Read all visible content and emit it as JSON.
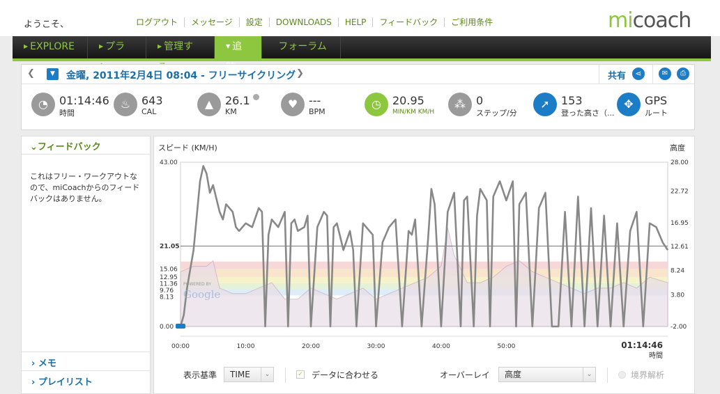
{
  "header": {
    "welcome": "ようこそ、",
    "links": [
      "ログアウト",
      "メッセージ",
      "設定",
      "DOWNLOADS",
      "HELP",
      "フィードバック",
      "ご利用条件"
    ],
    "logo_mi": "mi",
    "logo_coach": "coach"
  },
  "nav": {
    "items": [
      {
        "label": "EXPLORE",
        "active": false
      },
      {
        "label": "プラン",
        "active": false
      },
      {
        "label": "管理する",
        "active": false
      },
      {
        "label": "追跡",
        "active": true
      },
      {
        "label": "フォーラム",
        "active": false
      }
    ]
  },
  "workout": {
    "title": "金曜, 2011年2月4日 08:04 - フリーサイクリング",
    "share": "共有",
    "stats": [
      {
        "value": "01:14:46",
        "label": "時間",
        "icon": "clock-icon"
      },
      {
        "value": "643",
        "label": "CAL",
        "icon": "flame-icon"
      },
      {
        "value": "26.1",
        "label": "KM",
        "icon": "road-icon"
      },
      {
        "value": "---",
        "label": "BPM",
        "icon": "heart-icon"
      },
      {
        "value": "20.95",
        "label": "MIN/KM  KM/H",
        "icon": "speedometer-icon"
      },
      {
        "value": "0",
        "label": "ステップ/分",
        "icon": "footsteps-icon"
      },
      {
        "value": "153",
        "label": "登った高さ（...",
        "icon": "climb-arrow-icon"
      },
      {
        "value": "GPS",
        "label": "ルート",
        "icon": "gps-target-icon"
      }
    ]
  },
  "sidebar": {
    "feedback_title": "フィードバック",
    "feedback_text": "これはフリー・ワークアウトなので、miCoachからのフィードバックはありません。",
    "memo": "メモ",
    "playlist": "プレイリスト"
  },
  "chart_data": {
    "type": "line",
    "title": "",
    "ylabel_left": "スピード (KM/H)",
    "ylabel_right": "高度",
    "left_ticks": [
      "43.00",
      "21.05",
      "15.06",
      "12.95",
      "11.36",
      "9.76",
      "8.13",
      "0.00"
    ],
    "right_ticks": [
      "28.00",
      "22.72",
      "16.95",
      "12.61",
      "8.24",
      "3.80",
      "-2.00"
    ],
    "x_ticks": [
      "00:00",
      "10:00",
      "20:00",
      "30:00",
      "40:00",
      "50:00"
    ],
    "x_end": "01:14:46",
    "x_end_label": "時間",
    "ylim_speed": [
      0,
      43
    ],
    "ylim_altitude": [
      -2,
      28
    ],
    "average_speed": 21.05,
    "zone_colors": [
      "#d9ecf7",
      "#e3f1d3",
      "#f5f2c4",
      "#f7e2c6",
      "#f5d4d4"
    ],
    "map_watermark": "Google",
    "map_watermark_top": "POWERED BY",
    "series": [
      {
        "name": "スピード",
        "color": "#888888",
        "x": [
          0,
          0.5,
          1,
          2,
          3,
          3.5,
          4,
          4.5,
          5,
          6,
          6.5,
          7,
          8,
          8.5,
          9,
          10,
          11,
          12,
          12.5,
          13,
          13.5,
          14,
          15,
          16,
          16.5,
          17,
          17.5,
          18,
          19,
          19.5,
          20,
          21,
          22,
          22.5,
          23,
          23.5,
          24,
          25,
          26,
          26.5,
          27,
          28,
          29,
          29.5,
          30,
          31,
          32,
          33,
          34,
          35,
          35.5,
          36,
          37,
          38,
          38.5,
          39,
          40,
          41,
          42,
          43,
          43.5,
          44,
          45,
          45.5,
          46,
          47,
          47.5,
          48,
          49,
          50,
          51,
          51.5,
          52,
          53,
          54,
          55,
          55.5,
          56,
          57,
          58,
          59,
          60,
          61,
          62,
          63,
          64,
          65,
          66,
          67,
          68,
          69,
          70,
          71,
          72,
          73,
          74,
          74.77
        ],
        "values": [
          0,
          3,
          10,
          20,
          38,
          42,
          40,
          35,
          37,
          30,
          28,
          32,
          30,
          26,
          25,
          27,
          26,
          31,
          30,
          0,
          24,
          28,
          26,
          30,
          0,
          27,
          28,
          25,
          26,
          29,
          0,
          26,
          30,
          29,
          0,
          26,
          27,
          20,
          25,
          20,
          0,
          27,
          25,
          24,
          0,
          22,
          26,
          28,
          0,
          25,
          24,
          28,
          0,
          23,
          36,
          32,
          0,
          30,
          35,
          0,
          33,
          34,
          0,
          29,
          36,
          33,
          0,
          34,
          38,
          33,
          38,
          0,
          32,
          35,
          0,
          31,
          33,
          35,
          0,
          0,
          30,
          0,
          34,
          0,
          31,
          0,
          29,
          0,
          27,
          0,
          25,
          30,
          0,
          27,
          26,
          22,
          20
        ]
      },
      {
        "name": "高度",
        "color": "#c7a8c0",
        "x": [
          0,
          2,
          4,
          5,
          6,
          8,
          10,
          12,
          14,
          16,
          18,
          20,
          22,
          24,
          26,
          28,
          30,
          32,
          34,
          36,
          38,
          40,
          41,
          42,
          44,
          46,
          48,
          50,
          52,
          54,
          56,
          58,
          60,
          62,
          64,
          66,
          68,
          70,
          72,
          74.77
        ],
        "values": [
          8,
          9,
          9,
          10,
          5,
          4,
          4,
          5,
          6,
          3,
          3,
          5,
          4,
          3,
          4,
          5,
          3,
          4,
          5,
          6,
          7,
          9,
          16,
          11,
          6,
          6,
          7,
          9,
          10,
          8,
          7,
          6,
          5,
          4,
          5,
          5,
          6,
          5,
          7,
          6
        ]
      }
    ]
  },
  "controls": {
    "basis_label": "表示基準",
    "basis_value": "TIME",
    "fit_data": "データに合わせる",
    "overlay_label": "オーバーレイ",
    "overlay_value": "高度",
    "boundary_analysis": "境界解析"
  }
}
